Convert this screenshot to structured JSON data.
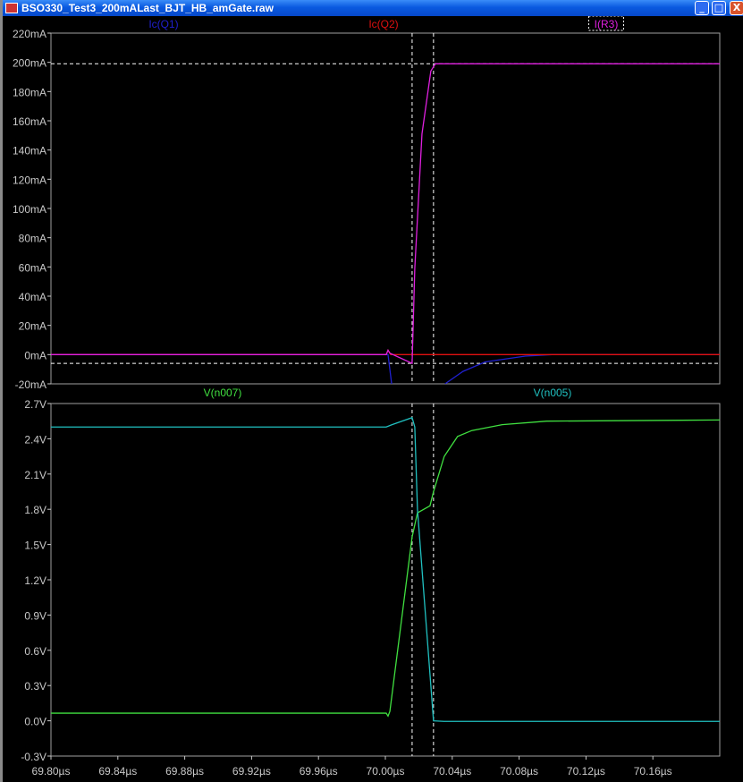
{
  "window": {
    "title": "BSO330_Test3_200mALast_BJT_HB_amGate.raw",
    "minimize": "_",
    "maximize": "□",
    "close": "X"
  },
  "colors": {
    "bg": "#000000",
    "axis": "#c8c8c8",
    "cursor": "#ffffff"
  },
  "chart_data": [
    {
      "type": "line",
      "panel": "top",
      "ylabel_unit": "mA",
      "ylim": [
        -20,
        220
      ],
      "xlim": [
        69.8,
        70.2
      ],
      "yticks": [
        220,
        200,
        180,
        160,
        140,
        120,
        100,
        80,
        60,
        40,
        20,
        0,
        -20
      ],
      "ytick_labels": [
        "220mA",
        "200mA",
        "180mA",
        "160mA",
        "140mA",
        "120mA",
        "100mA",
        "80mA",
        "60mA",
        "40mA",
        "20mA",
        "0mA",
        "-20mA"
      ],
      "grid": false,
      "cursors": {
        "x": [
          70.016,
          70.0288
        ],
        "y": [
          199,
          -6
        ]
      },
      "series": [
        {
          "name": "Ic(Q1)",
          "color": "#2020d0",
          "x": [
            69.8,
            70.0016,
            70.0043,
            70.0352
          ],
          "y": [
            0,
            0,
            -25,
            -25
          ],
          "x2": [
            70.0357,
            70.0464,
            70.0597,
            70.0837,
            70.0997,
            70.2
          ],
          "y2": [
            -20,
            -11.5,
            -5,
            -1,
            0,
            0
          ]
        },
        {
          "name": "Ic(Q2)",
          "color": "#e01010",
          "x": [
            69.8,
            70.0005,
            70.0016,
            70.0032,
            70.2
          ],
          "y": [
            0,
            0,
            3,
            0,
            0
          ]
        },
        {
          "name": "I(R3)",
          "color": "#e020e0",
          "boxed": true,
          "x": [
            69.8,
            70.0005,
            70.0016,
            70.0027,
            70.016,
            70.0176,
            70.0219,
            70.0272,
            70.0299,
            70.2
          ],
          "y": [
            0,
            0,
            3,
            1,
            -6,
            59,
            151,
            194,
            199,
            199
          ]
        }
      ]
    },
    {
      "type": "line",
      "panel": "bottom",
      "ylabel_unit": "V",
      "ylim": [
        -0.3,
        2.7
      ],
      "xlim": [
        69.8,
        70.2
      ],
      "yticks": [
        2.7,
        2.4,
        2.1,
        1.8,
        1.5,
        1.2,
        0.9,
        0.6,
        0.3,
        0.0,
        -0.3
      ],
      "ytick_labels": [
        "2.7V",
        "2.4V",
        "2.1V",
        "1.8V",
        "1.5V",
        "1.2V",
        "0.9V",
        "0.6V",
        "0.3V",
        "0.0V",
        "-0.3V"
      ],
      "xticks": [
        69.8,
        69.84,
        69.88,
        69.92,
        69.96,
        70.0,
        70.04,
        70.08,
        70.12,
        70.16
      ],
      "xtick_labels": [
        "69.80µs",
        "69.84µs",
        "69.88µs",
        "69.92µs",
        "69.96µs",
        "70.00µs",
        "70.04µs",
        "70.08µs",
        "70.12µs",
        "70.16µs"
      ],
      "grid": false,
      "cursors": {
        "x": [
          70.016,
          70.0288
        ]
      },
      "series": [
        {
          "name": "V(n007)",
          "color": "#40e040",
          "x": [
            69.8,
            70.0005,
            70.0016,
            70.0027,
            70.016,
            70.0192,
            70.0267,
            70.0288,
            70.0352,
            70.0432,
            70.0517,
            70.0699,
            70.0965,
            70.2
          ],
          "y": [
            0.065,
            0.065,
            0.04,
            0.08,
            1.565,
            1.77,
            1.83,
            1.95,
            2.25,
            2.42,
            2.47,
            2.52,
            2.55,
            2.56
          ]
        },
        {
          "name": "V(n005)",
          "color": "#20c0c0",
          "x": [
            69.8,
            70.0005,
            70.004,
            70.016,
            70.0176,
            70.0192,
            70.0288,
            70.035,
            70.2
          ],
          "y": [
            2.5,
            2.5,
            2.52,
            2.58,
            2.5,
            1.8,
            0.0,
            -0.005,
            -0.005
          ]
        }
      ]
    }
  ]
}
